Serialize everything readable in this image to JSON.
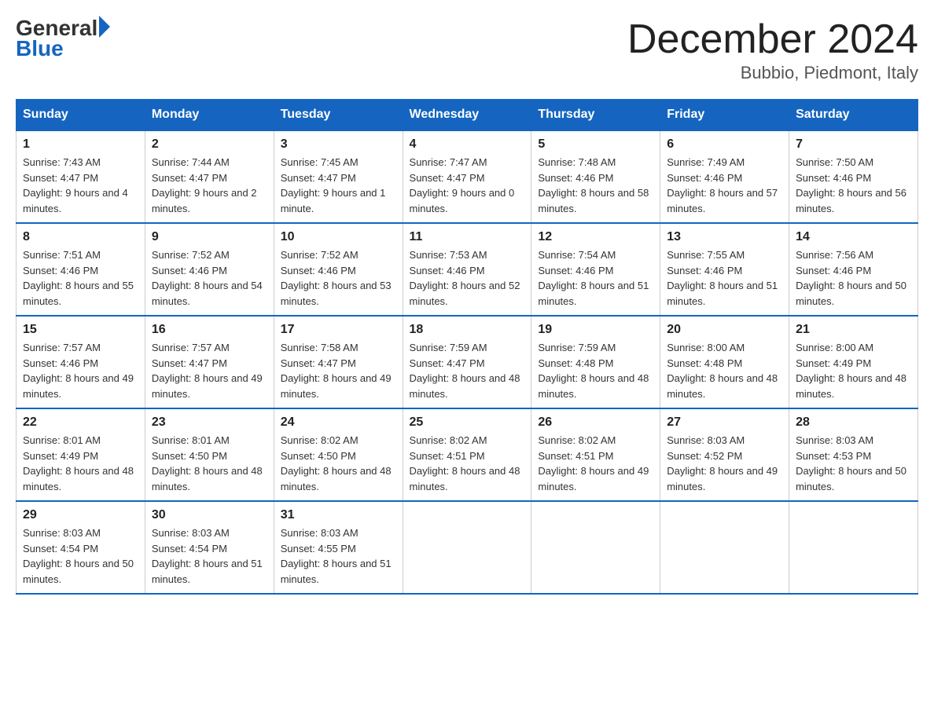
{
  "logo": {
    "general": "General",
    "arrow": "",
    "blue": "Blue"
  },
  "title": {
    "month_year": "December 2024",
    "location": "Bubbio, Piedmont, Italy"
  },
  "days_of_week": [
    "Sunday",
    "Monday",
    "Tuesday",
    "Wednesday",
    "Thursday",
    "Friday",
    "Saturday"
  ],
  "weeks": [
    [
      {
        "day": "1",
        "sunrise": "7:43 AM",
        "sunset": "4:47 PM",
        "daylight": "9 hours and 4 minutes."
      },
      {
        "day": "2",
        "sunrise": "7:44 AM",
        "sunset": "4:47 PM",
        "daylight": "9 hours and 2 minutes."
      },
      {
        "day": "3",
        "sunrise": "7:45 AM",
        "sunset": "4:47 PM",
        "daylight": "9 hours and 1 minute."
      },
      {
        "day": "4",
        "sunrise": "7:47 AM",
        "sunset": "4:47 PM",
        "daylight": "9 hours and 0 minutes."
      },
      {
        "day": "5",
        "sunrise": "7:48 AM",
        "sunset": "4:46 PM",
        "daylight": "8 hours and 58 minutes."
      },
      {
        "day": "6",
        "sunrise": "7:49 AM",
        "sunset": "4:46 PM",
        "daylight": "8 hours and 57 minutes."
      },
      {
        "day": "7",
        "sunrise": "7:50 AM",
        "sunset": "4:46 PM",
        "daylight": "8 hours and 56 minutes."
      }
    ],
    [
      {
        "day": "8",
        "sunrise": "7:51 AM",
        "sunset": "4:46 PM",
        "daylight": "8 hours and 55 minutes."
      },
      {
        "day": "9",
        "sunrise": "7:52 AM",
        "sunset": "4:46 PM",
        "daylight": "8 hours and 54 minutes."
      },
      {
        "day": "10",
        "sunrise": "7:52 AM",
        "sunset": "4:46 PM",
        "daylight": "8 hours and 53 minutes."
      },
      {
        "day": "11",
        "sunrise": "7:53 AM",
        "sunset": "4:46 PM",
        "daylight": "8 hours and 52 minutes."
      },
      {
        "day": "12",
        "sunrise": "7:54 AM",
        "sunset": "4:46 PM",
        "daylight": "8 hours and 51 minutes."
      },
      {
        "day": "13",
        "sunrise": "7:55 AM",
        "sunset": "4:46 PM",
        "daylight": "8 hours and 51 minutes."
      },
      {
        "day": "14",
        "sunrise": "7:56 AM",
        "sunset": "4:46 PM",
        "daylight": "8 hours and 50 minutes."
      }
    ],
    [
      {
        "day": "15",
        "sunrise": "7:57 AM",
        "sunset": "4:46 PM",
        "daylight": "8 hours and 49 minutes."
      },
      {
        "day": "16",
        "sunrise": "7:57 AM",
        "sunset": "4:47 PM",
        "daylight": "8 hours and 49 minutes."
      },
      {
        "day": "17",
        "sunrise": "7:58 AM",
        "sunset": "4:47 PM",
        "daylight": "8 hours and 49 minutes."
      },
      {
        "day": "18",
        "sunrise": "7:59 AM",
        "sunset": "4:47 PM",
        "daylight": "8 hours and 48 minutes."
      },
      {
        "day": "19",
        "sunrise": "7:59 AM",
        "sunset": "4:48 PM",
        "daylight": "8 hours and 48 minutes."
      },
      {
        "day": "20",
        "sunrise": "8:00 AM",
        "sunset": "4:48 PM",
        "daylight": "8 hours and 48 minutes."
      },
      {
        "day": "21",
        "sunrise": "8:00 AM",
        "sunset": "4:49 PM",
        "daylight": "8 hours and 48 minutes."
      }
    ],
    [
      {
        "day": "22",
        "sunrise": "8:01 AM",
        "sunset": "4:49 PM",
        "daylight": "8 hours and 48 minutes."
      },
      {
        "day": "23",
        "sunrise": "8:01 AM",
        "sunset": "4:50 PM",
        "daylight": "8 hours and 48 minutes."
      },
      {
        "day": "24",
        "sunrise": "8:02 AM",
        "sunset": "4:50 PM",
        "daylight": "8 hours and 48 minutes."
      },
      {
        "day": "25",
        "sunrise": "8:02 AM",
        "sunset": "4:51 PM",
        "daylight": "8 hours and 48 minutes."
      },
      {
        "day": "26",
        "sunrise": "8:02 AM",
        "sunset": "4:51 PM",
        "daylight": "8 hours and 49 minutes."
      },
      {
        "day": "27",
        "sunrise": "8:03 AM",
        "sunset": "4:52 PM",
        "daylight": "8 hours and 49 minutes."
      },
      {
        "day": "28",
        "sunrise": "8:03 AM",
        "sunset": "4:53 PM",
        "daylight": "8 hours and 50 minutes."
      }
    ],
    [
      {
        "day": "29",
        "sunrise": "8:03 AM",
        "sunset": "4:54 PM",
        "daylight": "8 hours and 50 minutes."
      },
      {
        "day": "30",
        "sunrise": "8:03 AM",
        "sunset": "4:54 PM",
        "daylight": "8 hours and 51 minutes."
      },
      {
        "day": "31",
        "sunrise": "8:03 AM",
        "sunset": "4:55 PM",
        "daylight": "8 hours and 51 minutes."
      },
      null,
      null,
      null,
      null
    ]
  ]
}
